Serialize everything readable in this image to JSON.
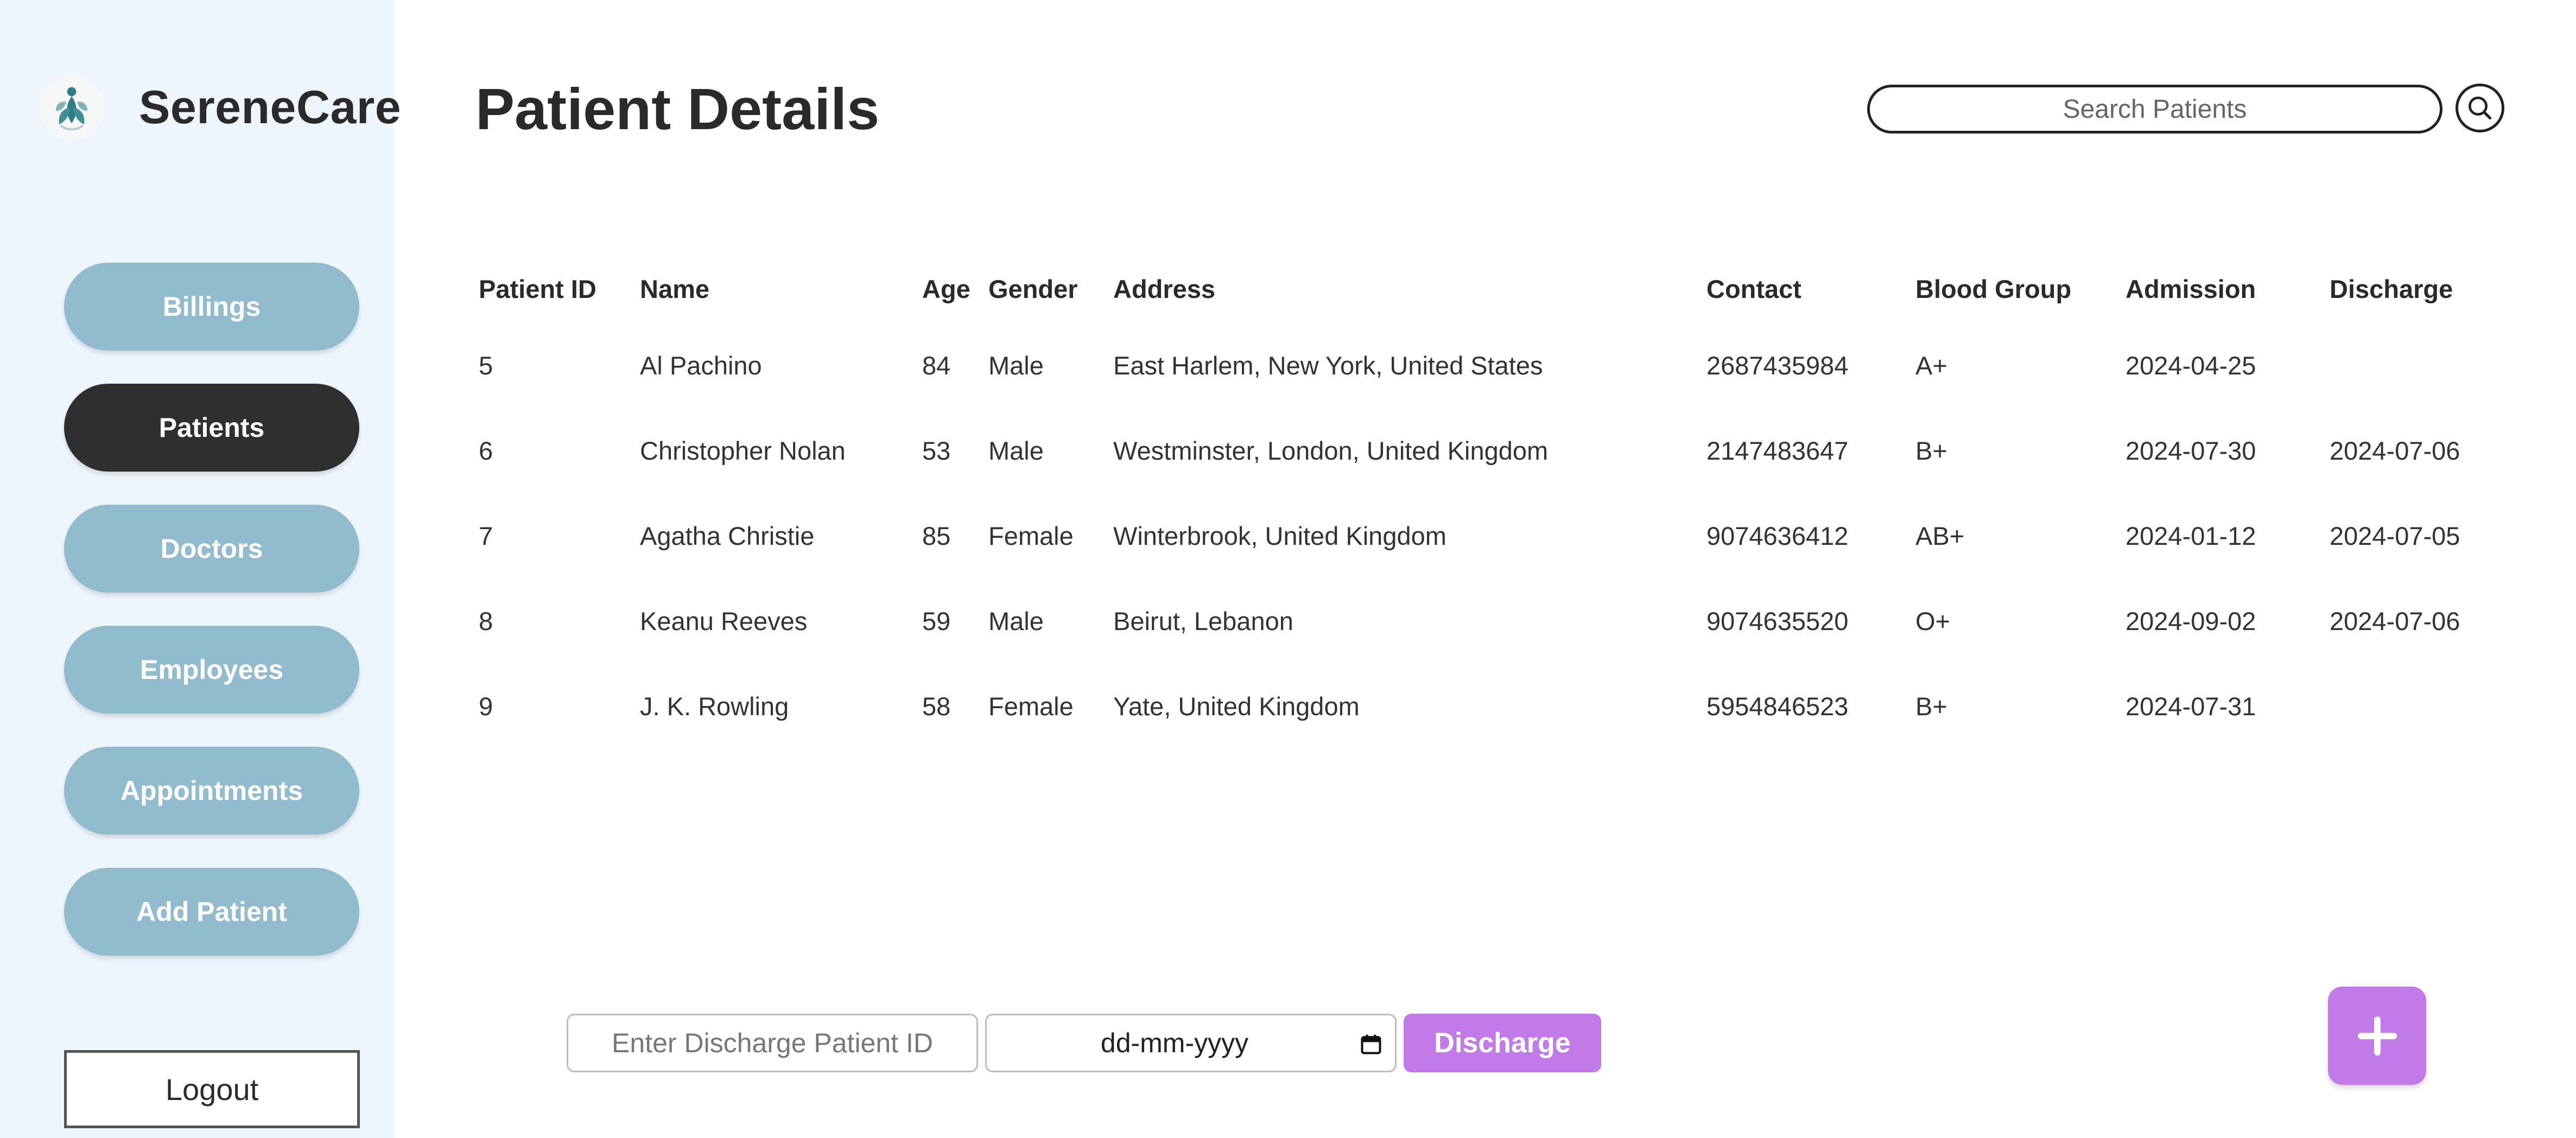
{
  "brand": {
    "name": "SereneCare"
  },
  "sidebar": {
    "items": [
      {
        "label": "Billings",
        "active": false
      },
      {
        "label": "Patients",
        "active": true
      },
      {
        "label": "Doctors",
        "active": false
      },
      {
        "label": "Employees",
        "active": false
      },
      {
        "label": "Appointments",
        "active": false
      },
      {
        "label": "Add Patient",
        "active": false
      }
    ],
    "logout_label": "Logout"
  },
  "header": {
    "title": "Patient Details",
    "search_placeholder": "Search Patients",
    "search_icon": "search-icon"
  },
  "table": {
    "columns": [
      "Patient ID",
      "Name",
      "Age",
      "Gender",
      "Address",
      "Contact",
      "Blood Group",
      "Admission",
      "Discharge"
    ],
    "rows": [
      [
        "5",
        "Al Pachino",
        "84",
        "Male",
        "East Harlem, New York, United States",
        "2687435984",
        "A+",
        "2024-04-25",
        ""
      ],
      [
        "6",
        "Christopher Nolan",
        "53",
        "Male",
        "Westminster, London, United Kingdom",
        "2147483647",
        "B+",
        "2024-07-30",
        "2024-07-06"
      ],
      [
        "7",
        "Agatha Christie",
        "85",
        "Female",
        "Winterbrook, United Kingdom",
        "9074636412",
        "AB+",
        "2024-01-12",
        "2024-07-05"
      ],
      [
        "8",
        "Keanu Reeves",
        "59",
        "Male",
        "Beirut, Lebanon",
        "9074635520",
        "O+",
        "2024-09-02",
        "2024-07-06"
      ],
      [
        "9",
        "J. K. Rowling",
        "58",
        "Female",
        "Yate, United Kingdom",
        "5954846523",
        "B+",
        "2024-07-31",
        ""
      ]
    ]
  },
  "discharge_form": {
    "id_placeholder": "Enter Discharge Patient ID",
    "date_placeholder": "dd-mm-yyyy",
    "button_label": "Discharge"
  },
  "colors": {
    "sidebar_bg": "#eef6fd",
    "nav_button": "#91bccd",
    "nav_active": "#2f2f2f",
    "accent_purple": "#c17ae8"
  }
}
